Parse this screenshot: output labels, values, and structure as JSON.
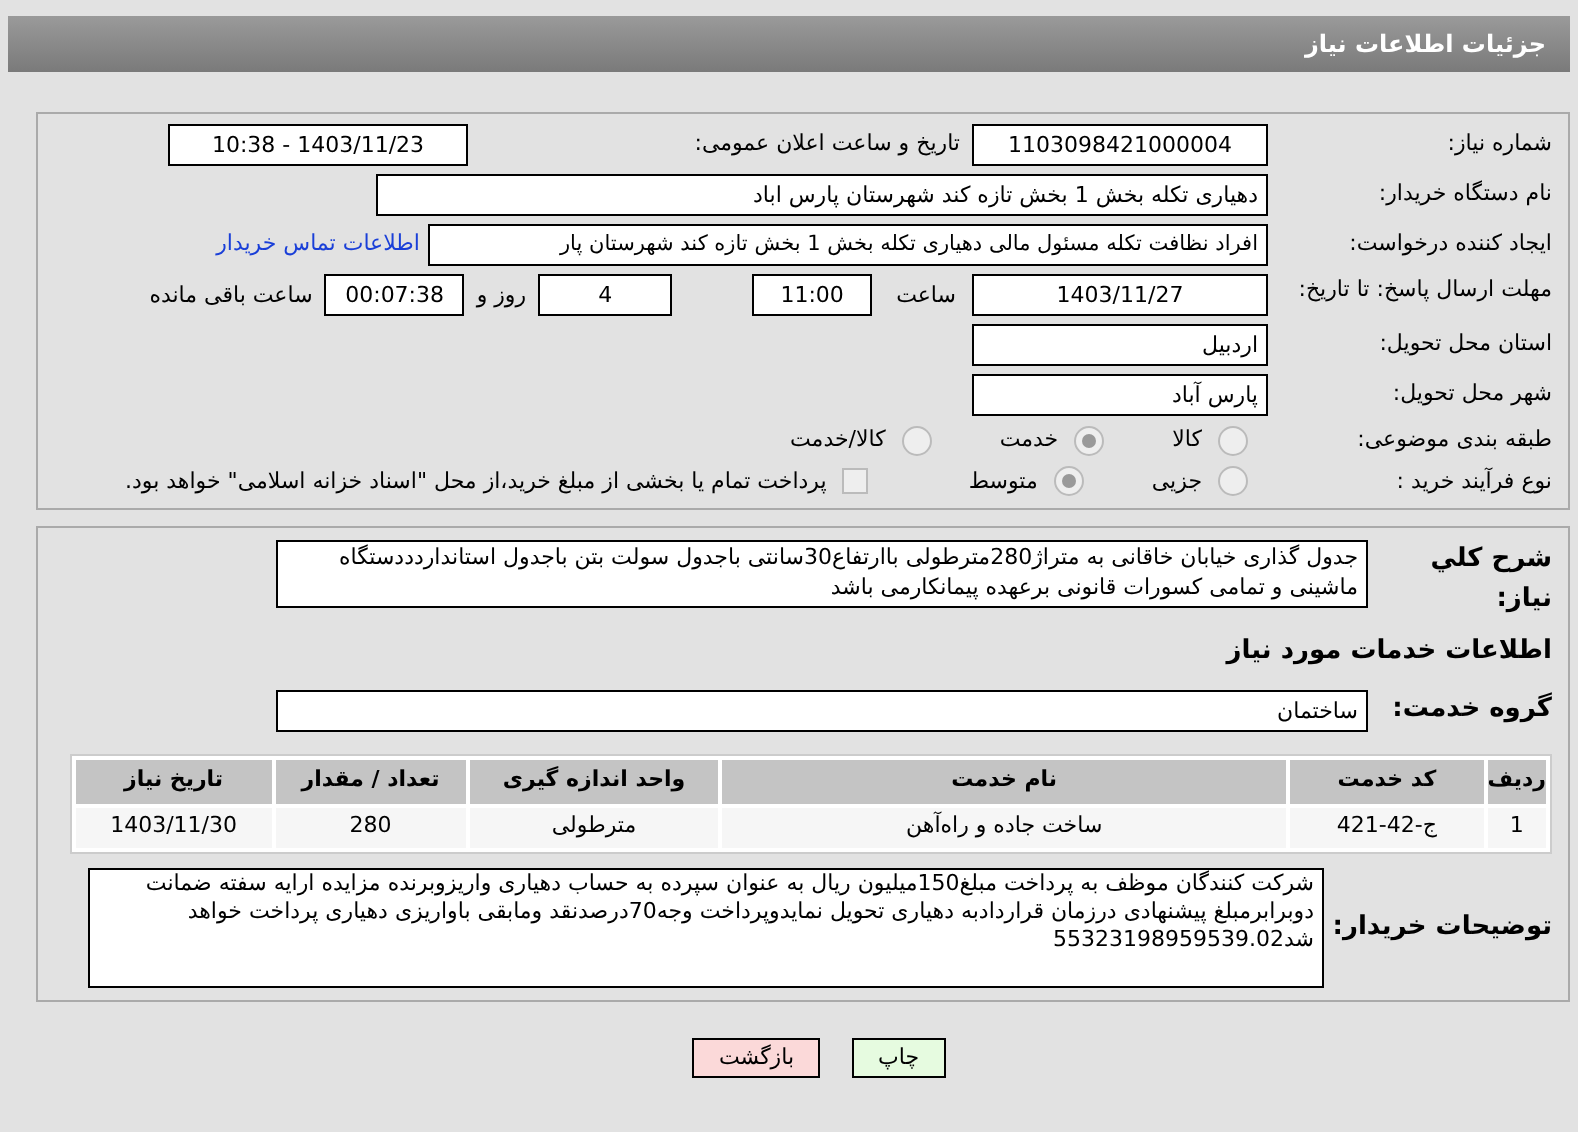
{
  "title": "جزئیات اطلاعات نیاز",
  "need_number": {
    "label": "شماره نیاز:",
    "value": "1103098421000004"
  },
  "announce": {
    "label": "تاریخ و ساعت اعلان عمومی:",
    "value": "1403/11/23 - 10:38"
  },
  "buyer_org": {
    "label": "نام دستگاه خریدار:",
    "value": "دهیاری تکله بخش 1 بخش تازه کند شهرستان پارس اباد"
  },
  "requester": {
    "label": "ایجاد کننده درخواست:",
    "value": "افراد نظافت تکله مسئول مالی دهیاری تکله بخش 1 بخش تازه کند شهرستان پار",
    "link": "اطلاعات تماس خریدار"
  },
  "deadline": {
    "label": "مهلت ارسال پاسخ: تا تاریخ:",
    "date": "1403/11/27",
    "time_label": "ساعت",
    "time": "11:00",
    "days": "4",
    "days_label": "روز و",
    "remaining": "00:07:38",
    "remaining_label": "ساعت باقی مانده"
  },
  "province": {
    "label": "استان محل تحویل:",
    "value": "اردبیل"
  },
  "city": {
    "label": "شهر محل تحویل:",
    "value": "پارس آباد"
  },
  "category": {
    "label": "طبقه بندی موضوعی:",
    "options": [
      {
        "label": "کالا",
        "selected": false
      },
      {
        "label": "خدمت",
        "selected": true
      },
      {
        "label": "کالا/خدمت",
        "selected": false
      }
    ]
  },
  "process": {
    "label": "نوع فرآیند خرید :",
    "options": [
      {
        "label": "جزیی",
        "selected": false
      },
      {
        "label": "متوسط",
        "selected": true
      }
    ],
    "checkbox": {
      "label": "پرداخت تمام یا بخشی از مبلغ خرید،از محل \"اسناد خزانه اسلامی\" خواهد بود.",
      "checked": false
    }
  },
  "description": {
    "label": "شرح کلي نياز:",
    "value": "جدول گذاری خیابان خاقانی به متراژ280مترطولی باارتفاع30سانتی باجدول سولت بتن باجدول استانداردددستگاه ماشینی و تمامی کسورات قانونی برعهده پیمانکارمی باشد"
  },
  "services_heading": "اطلاعات خدمات مورد نياز",
  "service_group": {
    "label": "گروه خدمت:",
    "value": "ساختمان"
  },
  "table": {
    "columns": [
      "ردیف",
      "کد خدمت",
      "نام خدمت",
      "واحد اندازه گیری",
      "تعداد / مقدار",
      "تاریخ نیاز"
    ],
    "rows": [
      [
        "1",
        "ج-42-421",
        "ساخت جاده و راه‌آهن",
        "مترطولی",
        "280",
        "1403/11/30"
      ]
    ]
  },
  "buyer_notes": {
    "label": "توضیحات خریدار:",
    "value": "شرکت کنندگان موظف به پرداخت مبلغ150میلیون ریال به عنوان سپرده به حساب دهیاری واریزوبرنده مزایده ارایه سفته ضمانت دوبرابرمبلغ پیشنهادی درزمان قراردادبه دهیاری تحویل نمایدوپرداخت وجه70درصدنقد ومابقی باواریزی دهیاری پرداخت خواهد شد55323198959539.02"
  },
  "buttons": [
    {
      "label": "چاپ",
      "kind": "print"
    },
    {
      "label": "بازگشت",
      "kind": "back"
    }
  ]
}
